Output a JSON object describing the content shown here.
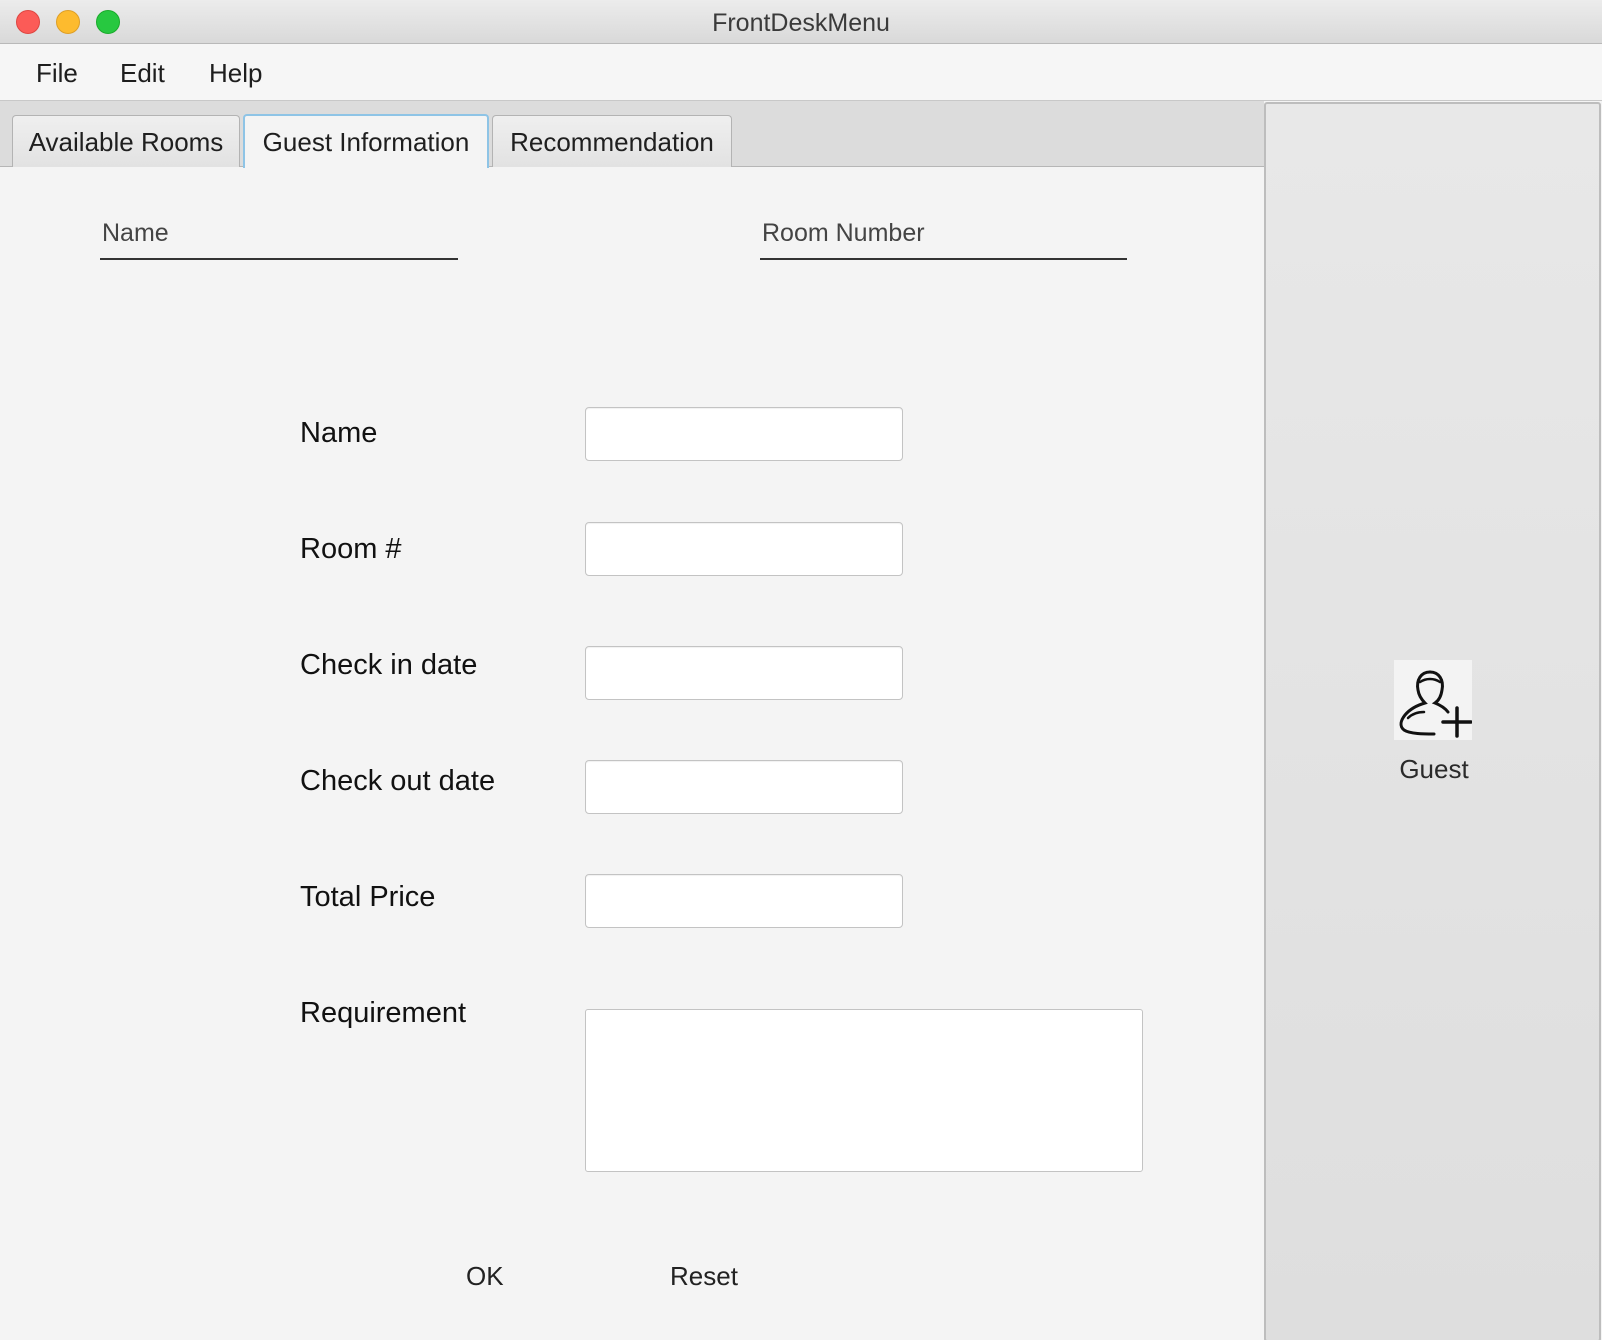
{
  "window": {
    "title": "FrontDeskMenu"
  },
  "menubar": {
    "items": [
      "File",
      "Edit",
      "Help"
    ]
  },
  "tabs": [
    {
      "label": "Available Rooms",
      "active": false
    },
    {
      "label": "Guest Information",
      "active": true
    },
    {
      "label": "Recommendation",
      "active": false
    }
  ],
  "header_fields": {
    "name_placeholder": "Name",
    "room_number_placeholder": "Room Number"
  },
  "form": {
    "name_label": "Name",
    "name_value": "",
    "room_label": "Room #",
    "room_value": "",
    "checkin_label": "Check in date",
    "checkin_value": "",
    "checkout_label": "Check out date",
    "checkout_value": "",
    "total_price_label": "Total Price",
    "total_price_value": "",
    "requirement_label": "Requirement",
    "requirement_value": ""
  },
  "actions": {
    "ok_label": "OK",
    "reset_label": "Reset"
  },
  "side_panel": {
    "guest_label": "Guest",
    "guest_icon": "add-user-icon"
  },
  "colors": {
    "close": "#fc5b57",
    "minimize": "#fdbb2e",
    "maximize": "#27c840",
    "active_tab_border": "#8ec4e6"
  }
}
